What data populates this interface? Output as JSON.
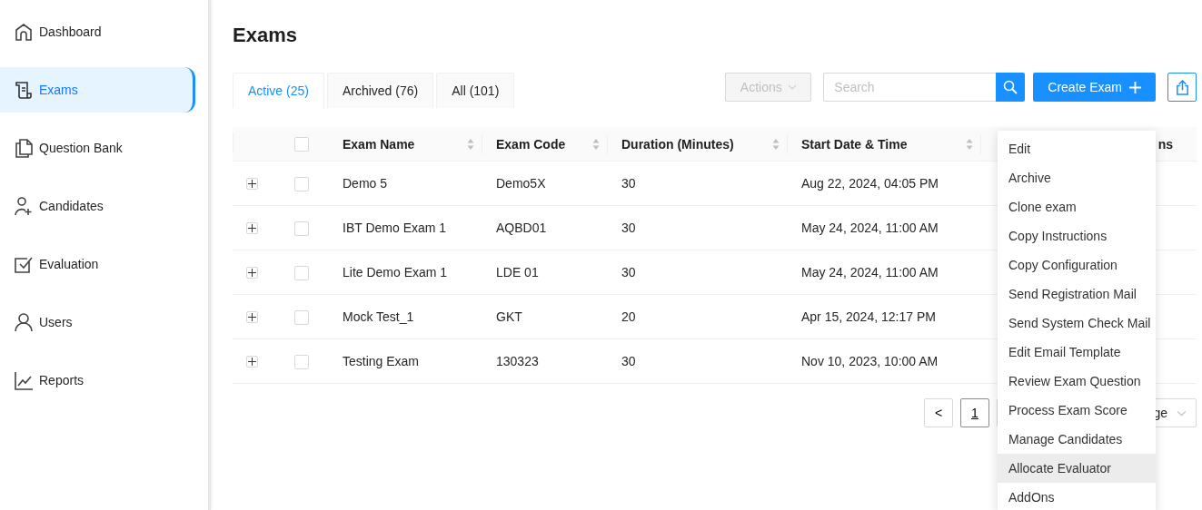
{
  "sidebar": {
    "items": [
      {
        "label": "Dashboard",
        "selected": false
      },
      {
        "label": "Exams",
        "selected": true
      },
      {
        "label": "Question Bank",
        "selected": false
      },
      {
        "label": "Candidates",
        "selected": false
      },
      {
        "label": "Evaluation",
        "selected": false
      },
      {
        "label": "Users",
        "selected": false
      },
      {
        "label": "Reports",
        "selected": false
      }
    ]
  },
  "page_title": "Exams",
  "tabs": [
    {
      "label": "Active (25)",
      "selected": true
    },
    {
      "label": "Archived (76)",
      "selected": false
    },
    {
      "label": "All (101)",
      "selected": false
    }
  ],
  "toolbar": {
    "actions_button": {
      "label": "Actions",
      "disabled": true
    },
    "search": {
      "placeholder": "Search"
    },
    "create_button": "Create Exam"
  },
  "table": {
    "all_checked": false,
    "columns": [
      {
        "label": "Exam Name",
        "sortable": true
      },
      {
        "label": "Exam Code",
        "sortable": true
      },
      {
        "label": "Duration (Minutes)",
        "sortable": true
      },
      {
        "label": "Start Date & Time",
        "sortable": true
      },
      {
        "label": "ns",
        "sortable": false
      }
    ],
    "rows": [
      {
        "name": "Demo 5",
        "code": "Demo5X",
        "duration": "30",
        "start": "Aug 22, 2024, 04:05 PM",
        "checked": false
      },
      {
        "name": "IBT Demo Exam 1",
        "code": "AQBD01",
        "duration": "30",
        "start": "May 24, 2024, 11:00 AM",
        "checked": false
      },
      {
        "name": "Lite Demo Exam 1",
        "code": "LDE 01",
        "duration": "30",
        "start": "May 24, 2024, 11:00 AM",
        "checked": false
      },
      {
        "name": "Mock Test_1",
        "code": "GKT",
        "duration": "20",
        "start": "Apr 15, 2024, 12:17 PM",
        "checked": false
      },
      {
        "name": "Testing Exam",
        "code": "130323",
        "duration": "30",
        "start": "Nov 10, 2023, 10:00 AM",
        "checked": false
      }
    ]
  },
  "pagination": {
    "prev": "<",
    "pages": [
      {
        "label": "1",
        "selected": true
      }
    ],
    "page_size": "ge"
  },
  "dropdown_menu": {
    "items": [
      {
        "label": "Edit",
        "highlighted": false
      },
      {
        "label": "Archive",
        "highlighted": false
      },
      {
        "label": "Clone exam",
        "highlighted": false
      },
      {
        "label": "Copy Instructions",
        "highlighted": false
      },
      {
        "label": "Copy Configuration",
        "highlighted": false
      },
      {
        "label": "Send Registration Mail",
        "highlighted": false
      },
      {
        "label": "Send System Check Mail",
        "highlighted": false
      },
      {
        "label": "Edit Email Template",
        "highlighted": false
      },
      {
        "label": "Review Exam Question",
        "highlighted": false
      },
      {
        "label": "Process Exam Score",
        "highlighted": false
      },
      {
        "label": "Manage Candidates",
        "highlighted": false
      },
      {
        "label": "Allocate Evaluator",
        "highlighted": true
      },
      {
        "label": "AddOns",
        "highlighted": false
      }
    ]
  }
}
